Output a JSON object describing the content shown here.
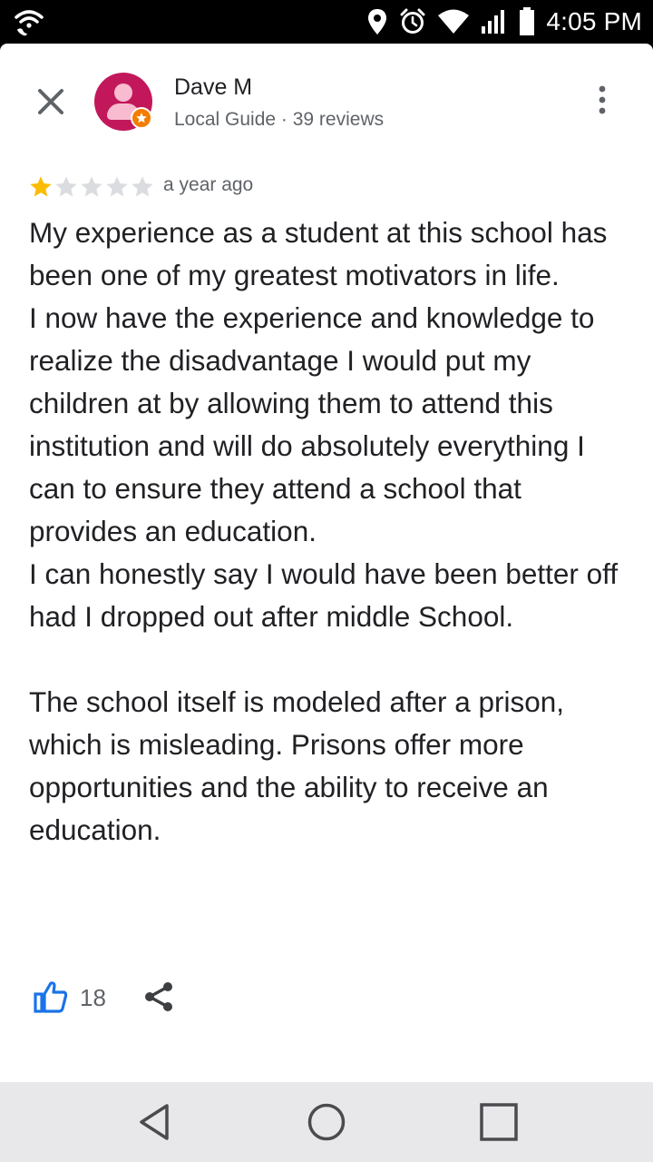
{
  "status_bar": {
    "time": "4:05 PM",
    "icons": [
      "wifi-calling-icon",
      "location-icon",
      "alarm-icon",
      "wifi-icon",
      "signal-icon",
      "battery-icon"
    ]
  },
  "reviewer": {
    "name": "Dave M",
    "subtitle": "Local Guide · 39 reviews",
    "badge_color": "#f57c00",
    "avatar_color": "#c2185b"
  },
  "review": {
    "rating": 1,
    "max_rating": 5,
    "time_ago": "a year ago",
    "paragraphs": [
      "My experience as a student at this school has been one of my greatest motivators in life.",
      "I now have the experience and knowledge to realize the disadvantage I would put my children at by allowing them to attend this institution and will do absolutely everything I can to ensure they attend a school that provides an education.",
      "I can honestly say I would have been better off had I dropped out after middle School.",
      "The school itself is modeled after a prison, which is misleading. Prisons offer more opportunities and the ability to receive an education."
    ]
  },
  "actions": {
    "like_count": "18",
    "like_color": "#1a73e8"
  },
  "colors": {
    "star_filled": "#fbbc04",
    "star_empty": "#dadce0"
  }
}
